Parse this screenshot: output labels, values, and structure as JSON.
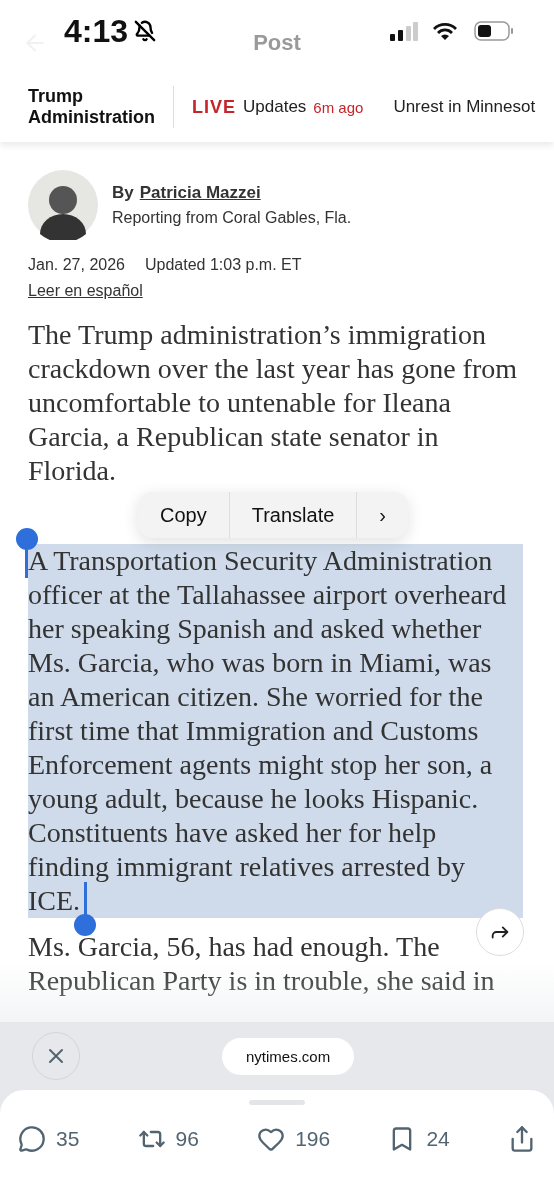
{
  "status_bar": {
    "time": "4:13",
    "silent": true
  },
  "nav": {
    "title": "Post"
  },
  "topic_bar": {
    "section": "Trump Administration",
    "live_label": "LIVE",
    "live_text": "Updates",
    "live_time": "6m ago",
    "next_topic": "Unrest in Minnesot"
  },
  "byline": {
    "prefix": "By",
    "author": "Patricia Mazzei",
    "location": "Reporting from Coral Gables, Fla."
  },
  "dateline": {
    "date": "Jan. 27, 2026",
    "updated": "Updated 1:03 p.m. ET",
    "language_link": "Leer en español"
  },
  "paragraphs": [
    {
      "text": "The Trump administration’s immigration crackdown over the last year has gone from uncomfortable to untenable for Ileana Garcia, a Republican state senator in Florida.",
      "selected": false
    },
    {
      "text": "A Transportation Security Administration officer at the Tallahassee airport overheard her speaking Spanish and asked whether Ms. Garcia, who was born in Miami, was an American citizen. She worried for the first time that Immigration and Customs Enforcement agents might stop her son, a young adult, because he looks Hispanic. Constituents have asked her for help finding immigrant relatives arrested by ICE.",
      "selected": true
    },
    {
      "text": "Ms. Garcia, 56, has had enough. The Republican Party is in trouble, she said in",
      "selected": false
    }
  ],
  "context_menu": {
    "items": [
      "Copy",
      "Translate"
    ],
    "more": "›"
  },
  "browser_bar": {
    "url": "nytimes.com"
  },
  "actions": [
    {
      "kind": "reply",
      "count": "35"
    },
    {
      "kind": "repost",
      "count": "96"
    },
    {
      "kind": "like",
      "count": "196"
    },
    {
      "kind": "bookmark",
      "count": "24"
    },
    {
      "kind": "share"
    }
  ]
}
